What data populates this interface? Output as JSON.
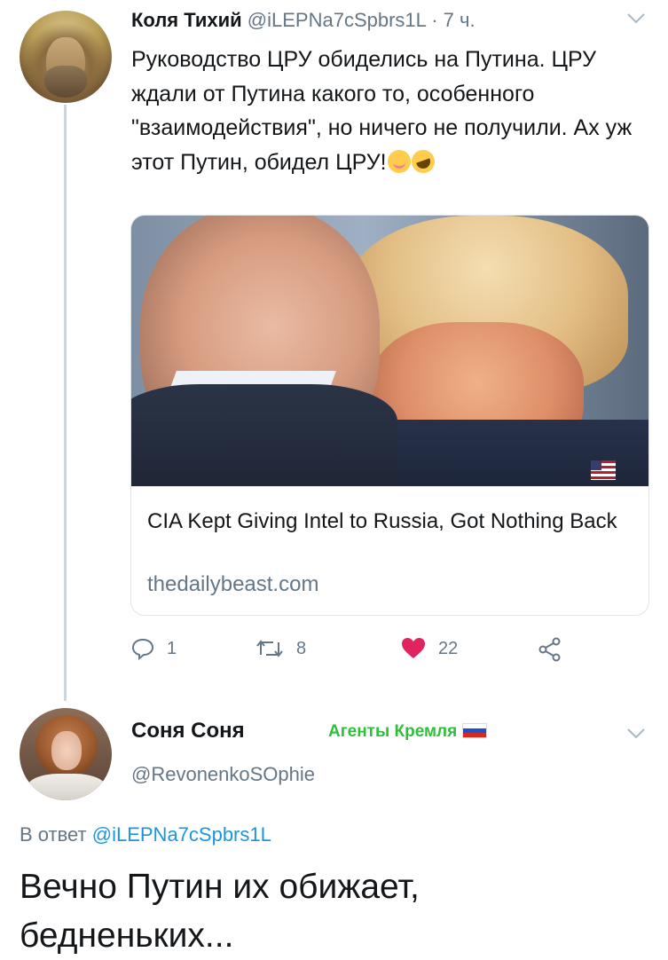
{
  "tweet1": {
    "name": "Коля Тихий",
    "handle": "@iLEPNa7cSpbrs1L",
    "time": "· 7 ч.",
    "text": "Руководство ЦРУ обиделись на Путина. ЦРУ ждали от Путина какого то, особенного \"взаимодействия\", но ничего не получили. Ах уж этот Путин, обидел ЦРУ!",
    "emojis": [
      "smiling-face-emoji",
      "rolling-laughing-emoji"
    ],
    "card": {
      "title": "CIA Kept Giving Intel to Russia, Got Nothing Back",
      "domain": "thedailybeast.com"
    },
    "actions": {
      "replies": "1",
      "retweets": "8",
      "likes": "22"
    },
    "colors": {
      "like": "#e0245e",
      "muted": "#657786"
    }
  },
  "tweet2": {
    "name": "Соня Соня",
    "label": "Агенты Кремля",
    "handle": "@RevonenkoSOphie",
    "reply_prefix": "В ответ ",
    "reply_mention": "@iLEPNa7cSpbrs1L",
    "text": "Вечно Путин их обижает, бедненьких...",
    "colors": {
      "label": "#2fbf3a",
      "mention": "#1b95e0"
    }
  }
}
